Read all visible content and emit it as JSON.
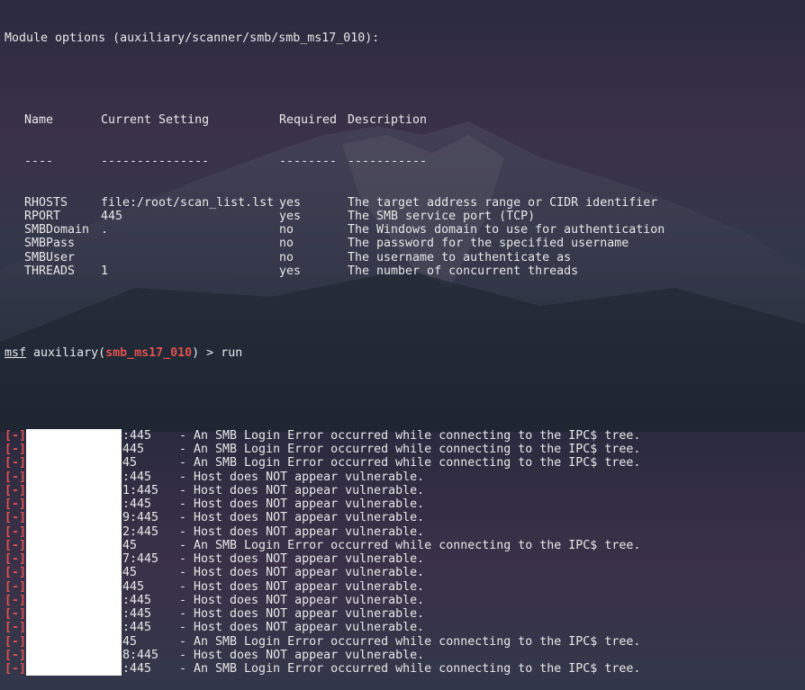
{
  "module_options_header": "Module options (auxiliary/scanner/smb/smb_ms17_010):",
  "table": {
    "headers": [
      "Name",
      "Current Setting",
      "Required",
      "Description"
    ],
    "underlines": [
      "----",
      "---------------",
      "--------",
      "-----------"
    ],
    "rows": [
      {
        "name": "RHOSTS",
        "setting": "file:/root/scan_list.lst",
        "required": "yes",
        "description": "The target address range or CIDR identifier"
      },
      {
        "name": "RPORT",
        "setting": "445",
        "required": "yes",
        "description": "The SMB service port (TCP)"
      },
      {
        "name": "SMBDomain",
        "setting": ".",
        "required": "no",
        "description": "The Windows domain to use for authentication"
      },
      {
        "name": "SMBPass",
        "setting": "",
        "required": "no",
        "description": "The password for the specified username"
      },
      {
        "name": "SMBUser",
        "setting": "",
        "required": "no",
        "description": "The username to authenticate as"
      },
      {
        "name": "THREADS",
        "setting": "1",
        "required": "yes",
        "description": "The number of concurrent threads"
      }
    ]
  },
  "prompt": {
    "msf": "msf",
    "auxiliary": " auxiliary(",
    "module": "smb_ms17_010",
    "close": ")",
    "arrow": " > ",
    "command": "run"
  },
  "log_tag": "[-]",
  "log": [
    {
      "port": ":445",
      "message": "- An SMB Login Error occurred while connecting to the IPC$ tree."
    },
    {
      "port": "445",
      "message": "- An SMB Login Error occurred while connecting to the IPC$ tree."
    },
    {
      "port": "45",
      "message": "- An SMB Login Error occurred while connecting to the IPC$ tree."
    },
    {
      "port": ":445",
      "message": "- Host does NOT appear vulnerable."
    },
    {
      "port": "1:445",
      "message": "- Host does NOT appear vulnerable."
    },
    {
      "port": ":445",
      "message": "- Host does NOT appear vulnerable."
    },
    {
      "port": "9:445",
      "message": "- Host does NOT appear vulnerable."
    },
    {
      "port": "2:445",
      "message": "- Host does NOT appear vulnerable."
    },
    {
      "port": "45",
      "message": "- An SMB Login Error occurred while connecting to the IPC$ tree."
    },
    {
      "port": "7:445",
      "message": "- Host does NOT appear vulnerable."
    },
    {
      "port": "45",
      "message": "- Host does NOT appear vulnerable."
    },
    {
      "port": "445",
      "message": "- Host does NOT appear vulnerable."
    },
    {
      "port": ":445",
      "message": "- Host does NOT appear vulnerable."
    },
    {
      "port": ":445",
      "message": "- Host does NOT appear vulnerable."
    },
    {
      "port": ":445",
      "message": "- Host does NOT appear vulnerable."
    },
    {
      "port": "45",
      "message": "- An SMB Login Error occurred while connecting to the IPC$ tree."
    },
    {
      "port": "8:445",
      "message": "- Host does NOT appear vulnerable."
    },
    {
      "port": ":445",
      "message": "- An SMB Login Error occurred while connecting to the IPC$ tree."
    }
  ],
  "colors": {
    "error_tag": "#e0524f",
    "text": "#e8e8e8",
    "redaction": "#ffffff"
  }
}
